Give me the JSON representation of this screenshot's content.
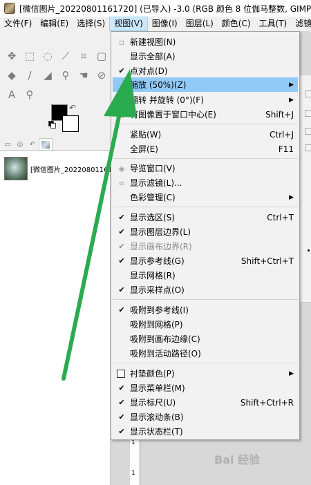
{
  "window": {
    "title": "[微信图片_20220801161720] (已导入) -3.0 (RGB 颜色 8 位伽马整数, GIMP b"
  },
  "menubar": {
    "items": [
      {
        "label": "文件(F)"
      },
      {
        "label": "编辑(E)"
      },
      {
        "label": "选择(S)"
      },
      {
        "label": "视图(V)"
      },
      {
        "label": "图像(I)"
      },
      {
        "label": "图层(L)"
      },
      {
        "label": "颜色(C)"
      },
      {
        "label": "工具(T)"
      },
      {
        "label": "滤镜"
      }
    ]
  },
  "image_list": {
    "name": "[微信图片_202208011617"
  },
  "ruler": {
    "tick1": "1",
    "tick2": "1"
  },
  "view_menu": {
    "items": [
      {
        "label": "新建视图(N)",
        "icon": "new-view-icon"
      },
      {
        "label": "显示全部(A)"
      },
      {
        "label": "点对点(D)",
        "checked": true
      },
      {
        "label": "缩放 (50%)(Z)",
        "submenu": true,
        "highlighted": true
      },
      {
        "label": "翻转 并旋转 (0°)(F)",
        "submenu": true,
        "icon": "flip-rotate-icon"
      },
      {
        "label": "将图像置于窗口中心(E)",
        "shortcut": "Shift+J",
        "icon": "center-image-icon"
      },
      {
        "label": "紧贴(W)",
        "shortcut": "Ctrl+J"
      },
      {
        "label": "全屏(E)",
        "shortcut": "F11"
      },
      {
        "label": "导览窗口(V)",
        "icon": "navigation-icon"
      },
      {
        "label": "显示滤镜(L)...",
        "icon": "display-filters-icon"
      },
      {
        "label": "色彩管理(C)",
        "submenu": true
      },
      {
        "label": "显示选区(S)",
        "shortcut": "Ctrl+T",
        "checked": true
      },
      {
        "label": "显示图层边界(L)",
        "checked": true
      },
      {
        "label": "显示画布边界(R)",
        "checked": true,
        "disabled": true
      },
      {
        "label": "显示参考线(G)",
        "shortcut": "Shift+Ctrl+T",
        "checked": true
      },
      {
        "label": "显示网格(R)"
      },
      {
        "label": "显示采样点(O)",
        "checked": true
      },
      {
        "label": "吸附到参考线(I)",
        "checked": true
      },
      {
        "label": "吸附到网格(P)"
      },
      {
        "label": "吸附到画布边缘(C)"
      },
      {
        "label": "吸附到活动路径(O)"
      },
      {
        "label": "衬垫颜色(P)",
        "submenu": true,
        "checkbox": true
      },
      {
        "label": "显示菜单栏(M)",
        "checked": true
      },
      {
        "label": "显示标尺(U)",
        "shortcut": "Shift+Ctrl+R",
        "checked": true
      },
      {
        "label": "显示滚动条(B)",
        "checked": true
      },
      {
        "label": "显示状态栏(T)",
        "checked": true
      }
    ]
  },
  "colors": {
    "highlight": "#91c9f7",
    "arrow": "#2bab4f",
    "menu_bg": "#f2f2f2"
  },
  "watermark": {
    "text": "Bai 经验"
  }
}
